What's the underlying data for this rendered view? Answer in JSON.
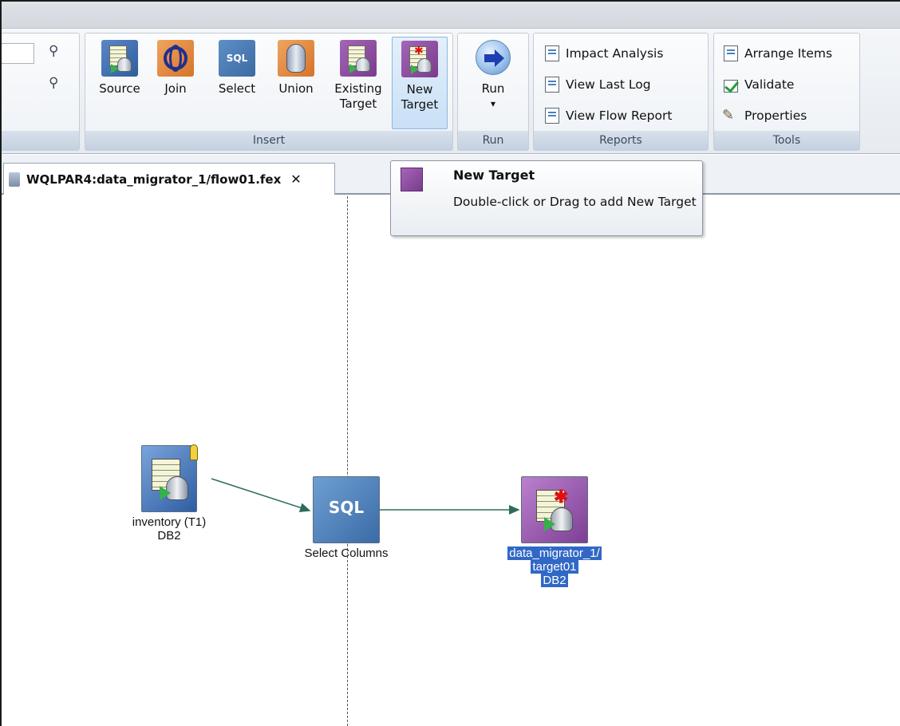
{
  "ribbon": {
    "insert": {
      "label": "Insert",
      "buttons": {
        "source": "Source",
        "join": "Join",
        "select": "Select",
        "union": "Union",
        "existing_target_1": "Existing",
        "existing_target_2": "Target",
        "new_target_1": "New",
        "new_target_2": "Target"
      },
      "select_icon_text": "SQL"
    },
    "run": {
      "label": "Run",
      "button": "Run",
      "dropdown": "▾"
    },
    "reports": {
      "label": "Reports",
      "items": {
        "impact_analysis": "Impact Analysis",
        "view_last_log": "View Last Log",
        "view_flow_report": "View Flow Report"
      }
    },
    "tools": {
      "label": "Tools",
      "items": {
        "arrange_items": "Arrange Items",
        "validate": "Validate",
        "properties": "Properties"
      }
    }
  },
  "tab": {
    "title": "WQLPAR4:data_migrator_1/flow01.fex",
    "close": "✕"
  },
  "tooltip": {
    "title": "New Target",
    "body": "Double-click or Drag to add New Target"
  },
  "flow": {
    "source_node": {
      "line1": "inventory (T1)",
      "line2": "DB2"
    },
    "select_node": {
      "icon_text": "SQL",
      "label": "Select Columns"
    },
    "target_node": {
      "line1": "data_migrator_1/",
      "line2": "target01",
      "line3": "DB2"
    }
  },
  "colors": {
    "connector": "#2e6b5e",
    "selection": "#3168c6",
    "target_purple": "#7d3f93",
    "source_blue": "#2f5da3"
  }
}
